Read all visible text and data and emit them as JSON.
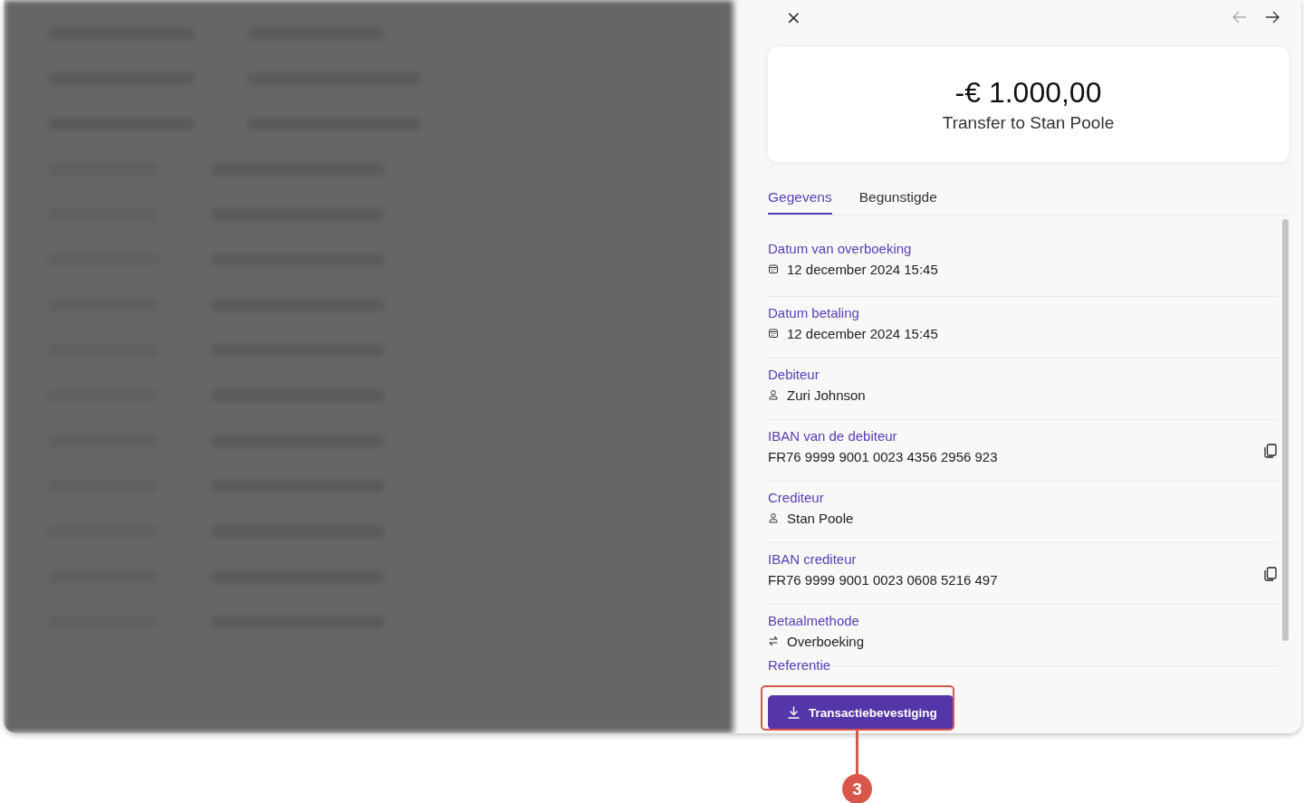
{
  "drawer": {
    "close": "×",
    "nav": [
      {
        "kind": "previous",
        "disabled": true
      },
      {
        "kind": "next",
        "disabled": false
      }
    ]
  },
  "summary": {
    "amount": "-€ 1.000,00",
    "title": "Transfer to Stan Poole"
  },
  "tabs": [
    {
      "label": "Gegevens",
      "selected": true
    },
    {
      "label": "Begunstigde",
      "selected": false
    }
  ],
  "fields": [
    {
      "label": "Datum van overboeking",
      "value": "12 december 2024 15:45",
      "kind": "date",
      "copyable": false
    },
    {
      "label": "Datum betaling",
      "value": "12 december 2024 15:45",
      "kind": "date",
      "copyable": false
    },
    {
      "label": "Debiteur",
      "value": "Zuri Johnson",
      "kind": "party",
      "copyable": false
    },
    {
      "label": "IBAN van de debiteur",
      "value": "FR76 9999 9001 0023 4356 2956 923",
      "kind": "iban",
      "copyable": true
    },
    {
      "label": "Crediteur",
      "value": "Stan Poole",
      "kind": "party",
      "copyable": false
    },
    {
      "label": "IBAN crediteur",
      "value": "FR76 9999 9001 0023 0608 5216 497",
      "kind": "iban",
      "copyable": true
    },
    {
      "label": "Betaalmethode",
      "value": "Overboeking",
      "kind": "method",
      "copyable": false
    },
    {
      "label": "Referentie"
    }
  ],
  "download_button": {
    "label": "Transactiebevestiging"
  },
  "annotation": {
    "number": "3"
  }
}
